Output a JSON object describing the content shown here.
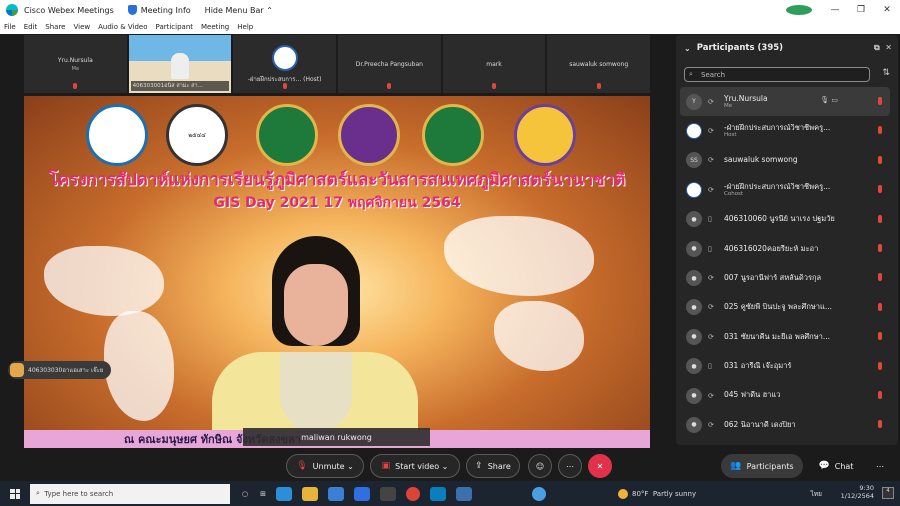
{
  "titlebar": {
    "app": "Cisco Webex Meetings",
    "meeting_info": "Meeting Info",
    "hide_menu": "Hide Menu Bar"
  },
  "menu": [
    "File",
    "Edit",
    "Share",
    "View",
    "Audio & Video",
    "Participant",
    "Meeting",
    "Help"
  ],
  "thumbnails": [
    {
      "name": "Yru.Nursula",
      "sub": "Me"
    },
    {
      "name": "406303001อนิส สามะ สา..."
    },
    {
      "name": "-ฝ่ายฝึกประสบการ... (Host)"
    },
    {
      "name": "Dr.Preecha Pangsuban"
    },
    {
      "name": "mark"
    },
    {
      "name": "sauwaluk somwong"
    }
  ],
  "slide": {
    "title": "โครงการสัปดาห์แห่งการเรียนรู้ภูมิศาสตร์และวันสารสนเทศภูมิศาสตร์นานาชาติ",
    "subtitle": "GIS Day 2021     17 พฤศจิกายน 2564",
    "bottom": "ณ คณะมนุษยศ                                  ทักษิณ จังหวัดสงขลา",
    "logo_year": "๒๕๔๔"
  },
  "presenter_name": "maliwan rukwong",
  "floating_chip": "406303030อาแอเสาะ เจ๊ะย",
  "controls": {
    "unmute": "Unmute",
    "start_video": "Start video",
    "share": "Share",
    "participants": "Participants",
    "chat": "Chat"
  },
  "panel": {
    "title": "Participants (395)",
    "search_placeholder": "Search",
    "participants": [
      {
        "initials": "Y",
        "name": "Yru.Nursula",
        "role": "Me"
      },
      {
        "initials": "",
        "name": "-ฝ่ายฝึกประสบการณ์วิชาชีพครู...",
        "role": "Host"
      },
      {
        "initials": "SS",
        "name": "sauwaluk somwong",
        "role": ""
      },
      {
        "initials": "",
        "name": "-ฝ่ายฝึกประสบการณ์วิชาชีพครู...",
        "role": "Cohost"
      },
      {
        "initials": "",
        "name": "406310060 นูรนีย์ นาเรง ปฐมวัย",
        "role": ""
      },
      {
        "initials": "",
        "name": "406316020คอยรียะห์ มะอา",
        "role": ""
      },
      {
        "initials": "",
        "name": "007 นูรอานีฟาร์ สหลันดิวรกุล",
        "role": ""
      },
      {
        "initials": "",
        "name": "025 คูซัยพี บินปะจู พละศึกษาแ...",
        "role": ""
      },
      {
        "initials": "",
        "name": "031 ซัยนาคีน มะยีเอ พลศึกษา...",
        "role": ""
      },
      {
        "initials": "",
        "name": "031 อารีณี เจ๊ะอุมาร์",
        "role": ""
      },
      {
        "initials": "",
        "name": "045 ฟาดีน ฮาแว",
        "role": ""
      },
      {
        "initials": "",
        "name": "062 นิอานาดี เดงปิยา",
        "role": ""
      }
    ]
  },
  "taskbar": {
    "search": "Type here to search",
    "temp": "80°F",
    "weather": "Partly sunny",
    "lang": "ไทย",
    "time": "9:30",
    "date": "1/12/2564",
    "notif": "4"
  },
  "colors": {
    "end_call": "#e0334b",
    "mute_red": "#e0463b",
    "slide_title": "#e02b6f"
  }
}
